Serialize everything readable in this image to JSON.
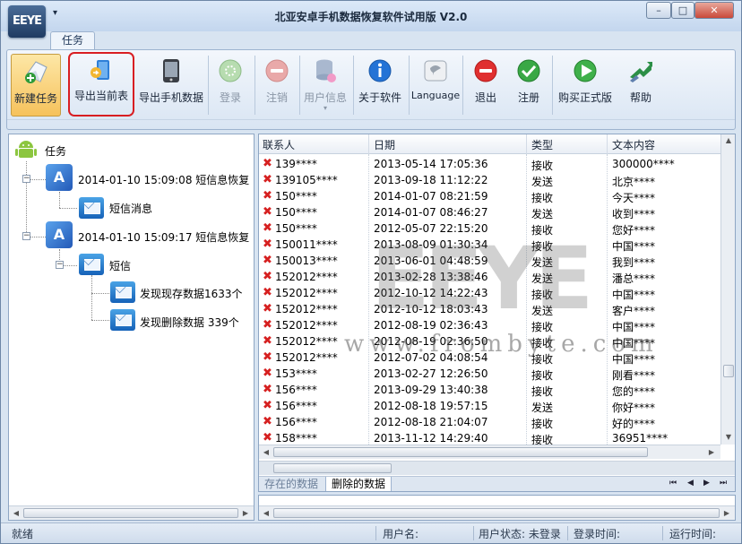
{
  "window": {
    "logo_text": "EEYE",
    "quick_access": "▾",
    "title": "北亚安卓手机数据恢复软件试用版 V2.0",
    "controls": {
      "minimize": "–",
      "maximize": "□",
      "close": "✕"
    }
  },
  "ribbon": {
    "tab": "任务",
    "buttons": [
      {
        "label": "新建任务",
        "icon": "new-task-icon",
        "state": "active"
      },
      {
        "label": "导出当前表",
        "icon": "export-table-icon",
        "state": "circled"
      },
      {
        "label": "导出手机数据",
        "icon": "phone-icon",
        "state": "enabled"
      },
      {
        "label": "登录",
        "icon": "login-icon",
        "state": "disabled"
      },
      {
        "label": "注销",
        "icon": "logout-icon",
        "state": "disabled"
      },
      {
        "label": "用户信息",
        "icon": "user-info-icon",
        "state": "disabled"
      },
      {
        "label": "关于软件",
        "icon": "info-icon",
        "state": "enabled"
      },
      {
        "label": "Language",
        "icon": "language-icon",
        "state": "enabled"
      },
      {
        "label": "退出",
        "icon": "exit-icon",
        "state": "enabled"
      },
      {
        "label": "注册",
        "icon": "register-icon",
        "state": "enabled"
      },
      {
        "label": "购买正式版",
        "icon": "buy-icon",
        "state": "enabled"
      },
      {
        "label": "帮助",
        "icon": "help-icon",
        "state": "enabled"
      }
    ],
    "dropdown_marker": "▾"
  },
  "tree": {
    "root": "任务",
    "tasks": [
      {
        "label": "2014-01-10 15:09:08 短信息恢复",
        "children": [
          {
            "label": "短信消息"
          }
        ]
      },
      {
        "label": "2014-01-10 15:09:17 短信息恢复",
        "children": [
          {
            "label": "短信",
            "children": [
              {
                "label": "发现现存数据1633个"
              },
              {
                "label": "发现删除数据 339个"
              }
            ]
          }
        ]
      }
    ],
    "expanded": "−"
  },
  "table": {
    "columns": [
      "联系人",
      "日期",
      "类型",
      "文本内容"
    ],
    "rows": [
      [
        "139****",
        "2013-05-14 17:05:36",
        "接收",
        "300000****"
      ],
      [
        "139105****",
        "2013-09-18 11:12:22",
        "发送",
        "北京****"
      ],
      [
        "150****",
        "2014-01-07 08:21:59",
        "接收",
        "今天****"
      ],
      [
        "150****",
        "2014-01-07 08:46:27",
        "发送",
        "收到****"
      ],
      [
        "150****",
        "2012-05-07 22:15:20",
        "接收",
        "您好****"
      ],
      [
        "150011****",
        "2013-08-09 01:30:34",
        "接收",
        "中国****"
      ],
      [
        "150013****",
        "2013-06-01 04:48:59",
        "发送",
        "我到****"
      ],
      [
        "152012****",
        "2013-02-28 13:38:46",
        "发送",
        "潘总****"
      ],
      [
        "152012****",
        "2012-10-12 14:22:43",
        "接收",
        "中国****"
      ],
      [
        "152012****",
        "2012-10-12 18:03:43",
        "发送",
        "客户****"
      ],
      [
        "152012****",
        "2012-08-19 02:36:43",
        "接收",
        "中国****"
      ],
      [
        "152012****",
        "2012-08-19 02:36:50",
        "接收",
        "中国****"
      ],
      [
        "152012****",
        "2012-07-02 04:08:54",
        "接收",
        "中国****"
      ],
      [
        "153****",
        "2013-02-27 12:26:50",
        "接收",
        "刚看****"
      ],
      [
        "156****",
        "2013-09-29 13:40:38",
        "接收",
        "您的****"
      ],
      [
        "156****",
        "2012-08-18 19:57:15",
        "发送",
        "你好****"
      ],
      [
        "156****",
        "2012-08-18 21:04:07",
        "接收",
        "好的****"
      ],
      [
        "158****",
        "2013-11-12 14:29:40",
        "接收",
        " 36951****"
      ]
    ],
    "deleted_mark": "✖",
    "watermark": "EEYE",
    "watermark_url": "www.frombyte.com",
    "bottom_tabs": [
      "存在的数据",
      "删除的数据"
    ],
    "nav": [
      "⏮",
      "◀",
      "▶",
      "⏭"
    ]
  },
  "statusbar": {
    "ready": "就绪",
    "user_name_label": "用户名:",
    "user_status": "用户状态: 未登录",
    "login_time_label": "登录时间:",
    "run_time_label": "运行时间:"
  }
}
